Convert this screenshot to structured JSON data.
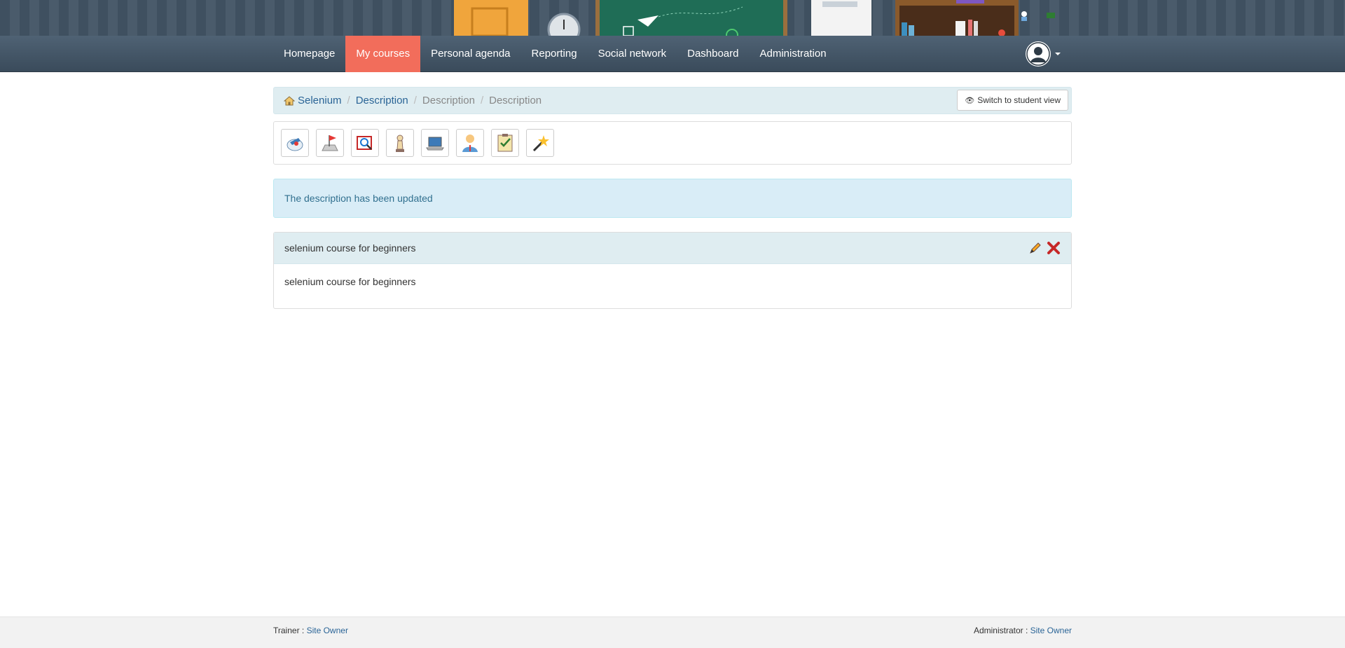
{
  "nav": {
    "items": [
      {
        "label": "Homepage",
        "active": false
      },
      {
        "label": "My courses",
        "active": true
      },
      {
        "label": "Personal agenda",
        "active": false
      },
      {
        "label": "Reporting",
        "active": false
      },
      {
        "label": "Social network",
        "active": false
      },
      {
        "label": "Dashboard",
        "active": false
      },
      {
        "label": "Administration",
        "active": false
      }
    ],
    "active_color": "#f26d5b"
  },
  "breadcrumb": {
    "items": [
      {
        "label": "Selenium",
        "link": true
      },
      {
        "label": "Description",
        "link": true
      },
      {
        "label": "Description",
        "link": false
      },
      {
        "label": "Description",
        "link": false
      }
    ],
    "student_view_label": "Switch to student view"
  },
  "toolbar": {
    "icons": [
      "course-description-icon",
      "course-progress-icon",
      "glossary-icon",
      "chess-piece-icon",
      "laptop-icon",
      "user-icon",
      "checklist-icon",
      "magic-wand-icon"
    ]
  },
  "alert": {
    "message": "The description has been updated"
  },
  "panel": {
    "title": "selenium course for beginners",
    "body": "selenium course for beginners"
  },
  "footer": {
    "trainer_label": "Trainer :",
    "trainer_name": "Site Owner",
    "admin_label": "Administrator :",
    "admin_name": "Site Owner"
  }
}
